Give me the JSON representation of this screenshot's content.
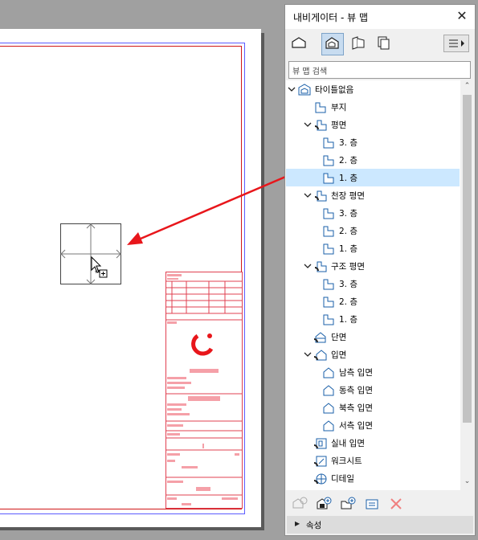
{
  "navigator": {
    "title": "내비게이터 - 뷰 맵",
    "close_icon": "close-icon",
    "search_placeholder": "뷰 맵 검색",
    "tabs": [
      {
        "icon": "project-map-icon",
        "active": false
      },
      {
        "icon": "view-map-icon",
        "active": true
      },
      {
        "icon": "layout-book-icon",
        "active": false
      },
      {
        "icon": "publisher-sets-icon",
        "active": false
      }
    ],
    "tree": [
      {
        "label": "타이틀없음",
        "icon": "view-map-root-icon",
        "level": 0,
        "expanded": true
      },
      {
        "label": "부지",
        "icon": "site-plan-icon",
        "level": 1
      },
      {
        "label": "평면",
        "icon": "folder-view-icon",
        "level": 1,
        "expanded": true
      },
      {
        "label": "3. 층",
        "icon": "floor-plan-icon",
        "level": 2
      },
      {
        "label": "2. 층",
        "icon": "floor-plan-icon",
        "level": 2
      },
      {
        "label": "1. 층",
        "icon": "floor-plan-icon",
        "level": 2,
        "selected": true
      },
      {
        "label": "천장 평면",
        "icon": "folder-view-icon",
        "level": 1,
        "expanded": true
      },
      {
        "label": "3. 층",
        "icon": "floor-plan-icon",
        "level": 2
      },
      {
        "label": "2. 층",
        "icon": "floor-plan-icon",
        "level": 2
      },
      {
        "label": "1. 층",
        "icon": "floor-plan-icon",
        "level": 2
      },
      {
        "label": "구조 평면",
        "icon": "folder-view-icon",
        "level": 1,
        "expanded": true
      },
      {
        "label": "3. 층",
        "icon": "floor-plan-icon",
        "level": 2
      },
      {
        "label": "2. 층",
        "icon": "floor-plan-icon",
        "level": 2
      },
      {
        "label": "1. 층",
        "icon": "floor-plan-icon",
        "level": 2
      },
      {
        "label": "단면",
        "icon": "section-icon",
        "level": 1
      },
      {
        "label": "입면",
        "icon": "elevation-folder-icon",
        "level": 1,
        "expanded": true
      },
      {
        "label": "남측 입면",
        "icon": "elevation-icon",
        "level": 2
      },
      {
        "label": "동측 입면",
        "icon": "elevation-icon",
        "level": 2
      },
      {
        "label": "북측 입면",
        "icon": "elevation-icon",
        "level": 2
      },
      {
        "label": "서측 입면",
        "icon": "elevation-icon",
        "level": 2
      },
      {
        "label": "실내 입면",
        "icon": "interior-elevation-icon",
        "level": 1
      },
      {
        "label": "워크시트",
        "icon": "worksheet-icon",
        "level": 1
      },
      {
        "label": "디테일",
        "icon": "detail-icon",
        "level": 1
      }
    ],
    "toolbar": [
      {
        "icon": "new-folder-disabled-icon",
        "enabled": false
      },
      {
        "icon": "save-view-icon",
        "enabled": true
      },
      {
        "icon": "new-folder-icon",
        "enabled": true
      },
      {
        "icon": "settings-icon",
        "enabled": true
      },
      {
        "icon": "delete-icon",
        "enabled": false
      }
    ],
    "properties_label": "속성"
  },
  "colors": {
    "selection": "#cce8ff",
    "red_annotation": "#e8161b",
    "title_block": "#f08c96"
  }
}
